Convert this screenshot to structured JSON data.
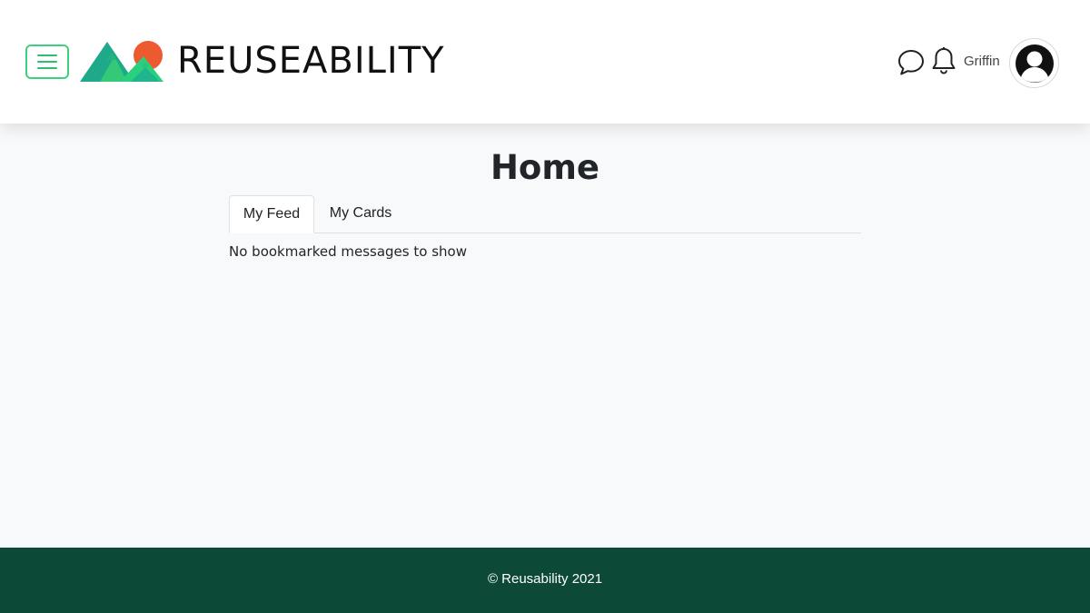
{
  "header": {
    "brand": "REUSEABILITY",
    "username": "Griffin",
    "icons": {
      "menu": "hamburger-menu-icon",
      "logo": "mountains-sun-logo",
      "messages": "chat-bubble-icon",
      "notifications": "bell-icon",
      "avatar": "user-avatar-icon"
    }
  },
  "main": {
    "title": "Home",
    "tabs": [
      {
        "label": "My Feed",
        "active": true
      },
      {
        "label": "My Cards",
        "active": false
      }
    ],
    "empty_message": "No bookmarked messages to show"
  },
  "footer": {
    "text": "© Reusability 2021"
  },
  "colors": {
    "accent": "#3ecf7f",
    "footer_bg": "#0c4a37",
    "sun": "#ee5a2f",
    "page_bg": "#f8f9fb"
  }
}
